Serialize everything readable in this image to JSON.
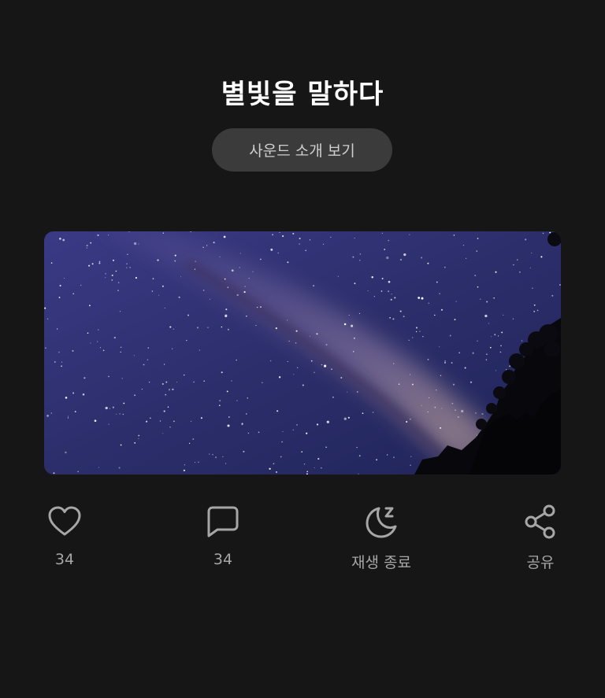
{
  "header": {
    "title": "별빛을 말하다",
    "intro_button_label": "사운드 소개 보기"
  },
  "hero_image": {
    "description_icon": "milky-way-night-sky-image"
  },
  "actions": {
    "like": {
      "icon": "heart-icon",
      "label": "34"
    },
    "comment": {
      "icon": "comment-icon",
      "label": "34"
    },
    "sleep_timer": {
      "icon": "moon-sleep-icon",
      "label": "재생 종료"
    },
    "share": {
      "icon": "share-icon",
      "label": "공유"
    }
  },
  "colors": {
    "background": "#161616",
    "button_bg": "#3b3b3b",
    "icon_color": "#a6a6a6",
    "sky_dark": "#1e2150",
    "sky_light": "#5a5aa0"
  }
}
